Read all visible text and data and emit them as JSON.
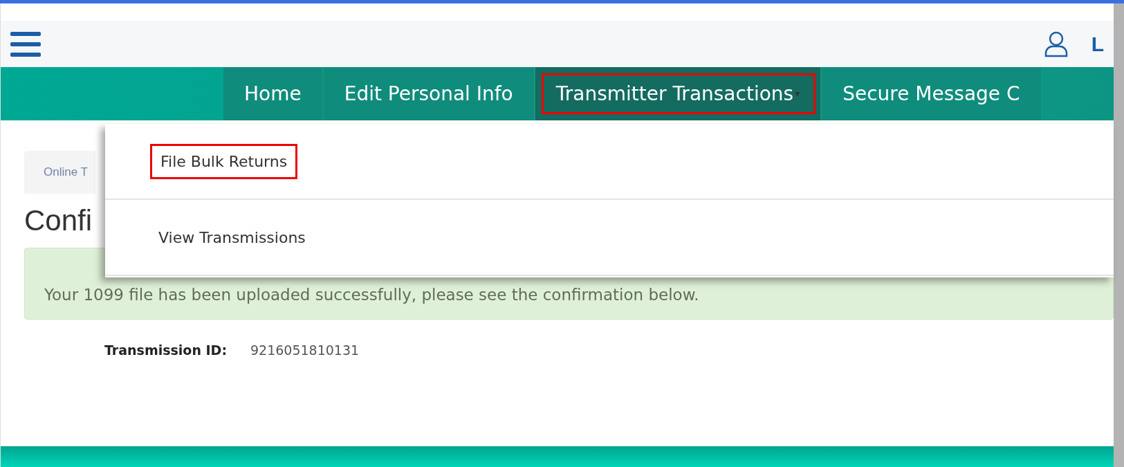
{
  "header": {
    "user_label": "L"
  },
  "nav": {
    "items": [
      {
        "label": "Home",
        "selected": false,
        "highlighted": false,
        "has_caret": false
      },
      {
        "label": "Edit Personal Info",
        "selected": false,
        "highlighted": false,
        "has_caret": false
      },
      {
        "label": "Transmitter Transactions",
        "selected": true,
        "highlighted": true,
        "has_caret": true,
        "caret": "▾"
      },
      {
        "label": "Secure Message C",
        "selected": false,
        "highlighted": false,
        "has_caret": false
      }
    ]
  },
  "dropdown": {
    "items": [
      {
        "label": "File Bulk Returns",
        "highlighted": true
      },
      {
        "label": "View Transmissions",
        "highlighted": false
      }
    ]
  },
  "breadcrumb": {
    "text": "Online T"
  },
  "heading": "Confi",
  "alert": {
    "message": "Your 1099 file has been uploaded successfully, please see the confirmation below."
  },
  "details": [
    {
      "label": "Transmission ID:",
      "value": "9216051810131"
    }
  ]
}
